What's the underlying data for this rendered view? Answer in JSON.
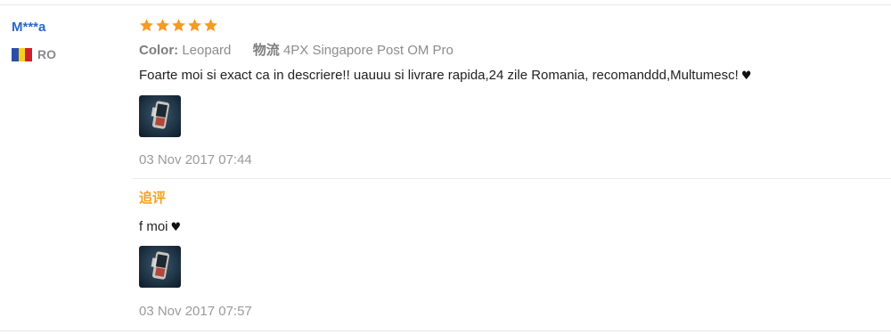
{
  "reviewer": {
    "name": "M***a",
    "country_code": "RO",
    "flag_colors": [
      "#2b4fa8",
      "#f6d11c",
      "#d0202a"
    ]
  },
  "review": {
    "rating": 5,
    "rating_max": 5,
    "star_color": "#f59a23",
    "color_label": "Color:",
    "color_value": "Leopard",
    "logistics_label": "物流",
    "logistics_value": "4PX Singapore Post OM Pro",
    "text": "Foarte moi si exact ca in descriere!! uauuu si livrare rapida,24 zile Romania, recomanddd,Multumesc!",
    "heart": "♥",
    "photo_icon": "review-photo-thumbnail",
    "date": "03 Nov 2017 07:44"
  },
  "followup": {
    "label": "追评",
    "label_color": "#f5a020",
    "text": "f moi",
    "heart": "♥",
    "photo_icon": "review-photo-thumbnail",
    "date": "03 Nov 2017 07:57"
  }
}
